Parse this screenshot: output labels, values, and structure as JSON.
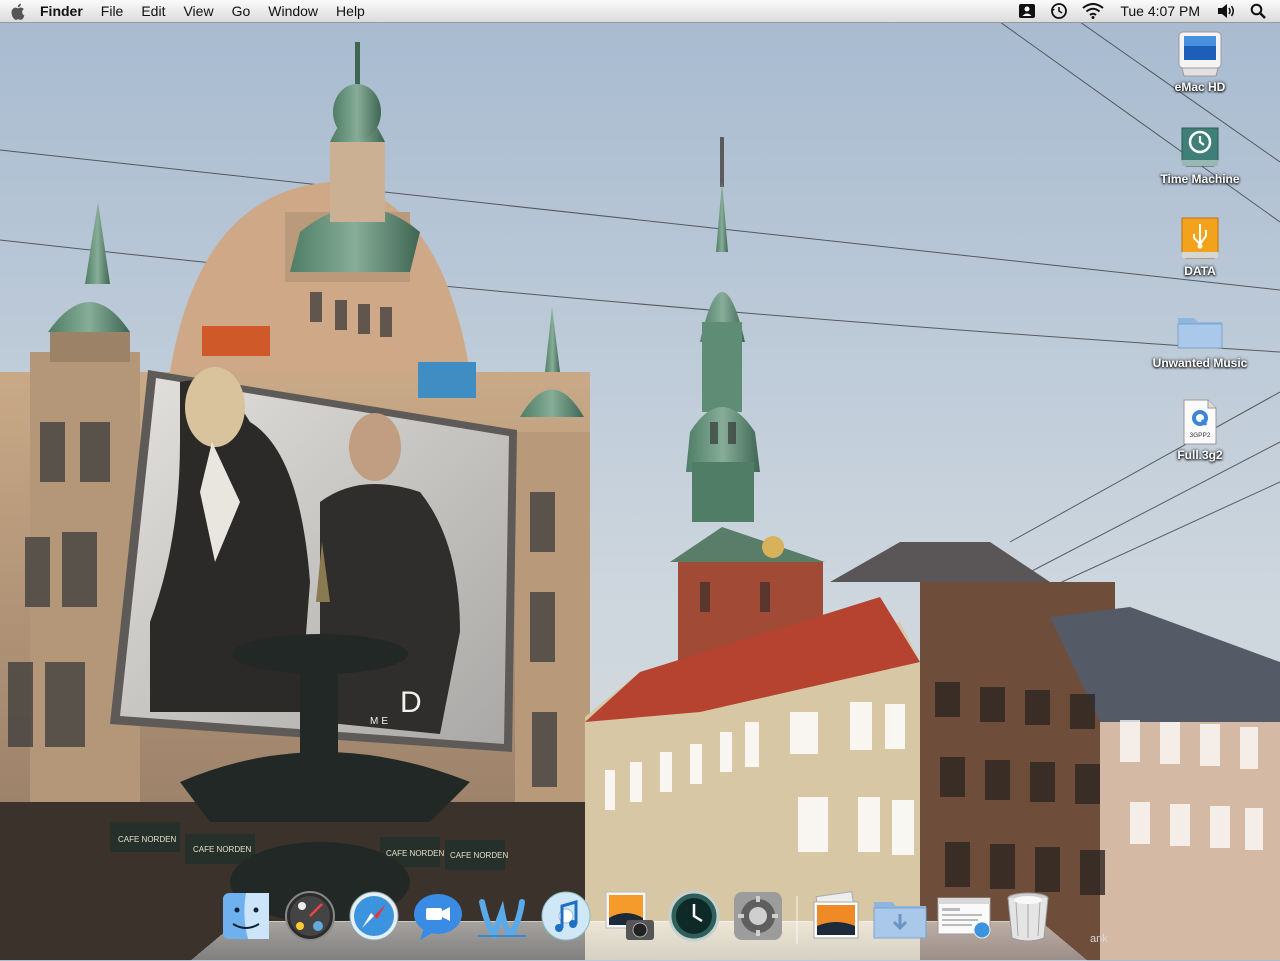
{
  "menubar": {
    "app_name": "Finder",
    "menus": [
      "File",
      "Edit",
      "View",
      "Go",
      "Window",
      "Help"
    ],
    "clock": "Tue 4:07 PM",
    "status_icons": [
      "user-switcher-icon",
      "time-machine-icon",
      "wifi-icon",
      "volume-icon",
      "spotlight-icon"
    ]
  },
  "desktop_icons": [
    {
      "label": "eMac HD",
      "icon": "hard-drive-icon"
    },
    {
      "label": "Time Machine",
      "icon": "time-machine-drive-icon"
    },
    {
      "label": "DATA",
      "icon": "usb-drive-icon"
    },
    {
      "label": "Unwanted Music",
      "icon": "folder-icon"
    },
    {
      "label": "Full.3g2",
      "icon": "quicktime-3gpp2-file-icon",
      "badge": "3GPP2"
    }
  ],
  "dock": {
    "apps": [
      "finder-icon",
      "dashboard-icon",
      "safari-icon",
      "ichat-icon",
      "iweb-icon",
      "itunes-icon",
      "iphoto-icon",
      "time-machine-icon",
      "system-preferences-icon"
    ],
    "right": [
      "pictures-stack-icon",
      "downloads-folder-icon",
      "web-page-document-icon",
      "trash-icon"
    ]
  },
  "wallpaper": {
    "billboard_text": "D",
    "billboard_subtext": "ME",
    "storefront_signs": [
      "CAFE NORDEN",
      "CAFE NORDEN",
      "CAFE NORDEN",
      "CAFE NORDEN"
    ],
    "bank_sign": "ank"
  }
}
